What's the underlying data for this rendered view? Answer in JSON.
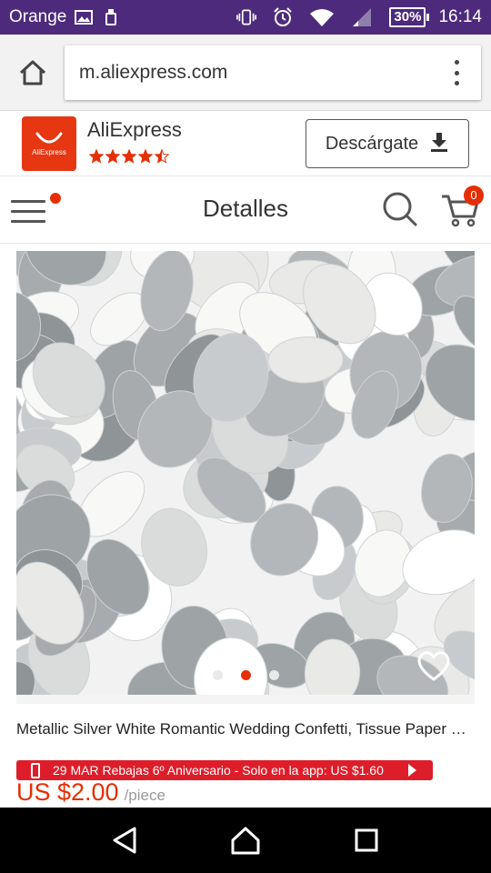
{
  "status_bar": {
    "carrier": "Orange",
    "battery": "30%",
    "time": "16:14",
    "icons": [
      "image-icon",
      "usb-icon",
      "vibrate-icon",
      "alarm-icon",
      "wifi-icon",
      "signal-icon",
      "battery-icon"
    ]
  },
  "browser": {
    "url": "m.aliexpress.com",
    "icons": [
      "home-icon",
      "overflow-menu-icon"
    ]
  },
  "app_banner": {
    "app_name": "AliExpress",
    "logo_text": "AliExpress",
    "rating": 4.5,
    "rating_max": 5,
    "download_label": "Descárgate",
    "colors": {
      "logo": "#e63612",
      "stars": "#e62e04"
    }
  },
  "header": {
    "title": "Detalles",
    "cart_count": "0",
    "icons": [
      "hamburger-menu-icon",
      "search-icon",
      "cart-icon"
    ]
  },
  "product": {
    "image_subject": "silver and white round paper confetti",
    "carousel_count": 3,
    "carousel_active": 2,
    "title": "Metallic Silver White Romantic Wedding Confetti, Tissue Paper Confetti",
    "promo": "29 MAR Rebajas 6º Aniversario - Solo en la app: US $1.60",
    "price": "US $2.00",
    "unit": "/piece",
    "colors": {
      "price": "#e62e04",
      "promo_bg": "#dd1e2a"
    }
  },
  "nav_bar": {
    "icons": [
      "back-icon",
      "home-icon",
      "recents-icon"
    ]
  }
}
